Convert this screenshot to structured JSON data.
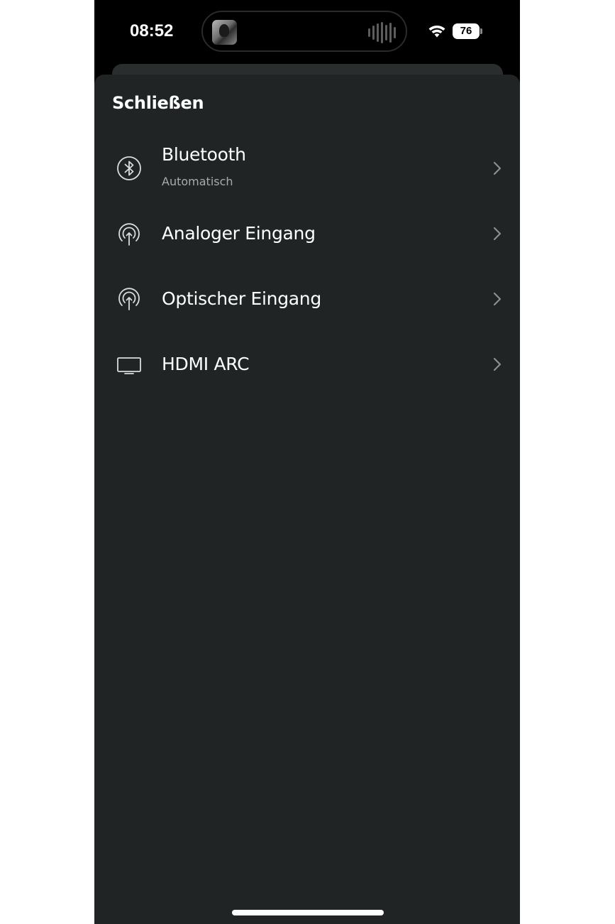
{
  "status_bar": {
    "time": "08:52",
    "battery_percent": "76",
    "icons": [
      "album-art-icon",
      "audio-waveform-icon",
      "wifi-icon",
      "battery-icon"
    ]
  },
  "sheet": {
    "close_label": "Schließen",
    "items": [
      {
        "icon": "bluetooth-icon",
        "title": "Bluetooth",
        "subtitle": "Automatisch"
      },
      {
        "icon": "audio-input-icon",
        "title": "Analoger Eingang"
      },
      {
        "icon": "audio-input-icon",
        "title": "Optischer Eingang"
      },
      {
        "icon": "tv-icon",
        "title": "HDMI ARC"
      }
    ]
  },
  "colors": {
    "background": "#000000",
    "sheet": "#202425",
    "text_primary": "#ffffff",
    "text_secondary": "#a7abad",
    "icon": "#d9dcdd",
    "chevron": "#8b8f91"
  }
}
